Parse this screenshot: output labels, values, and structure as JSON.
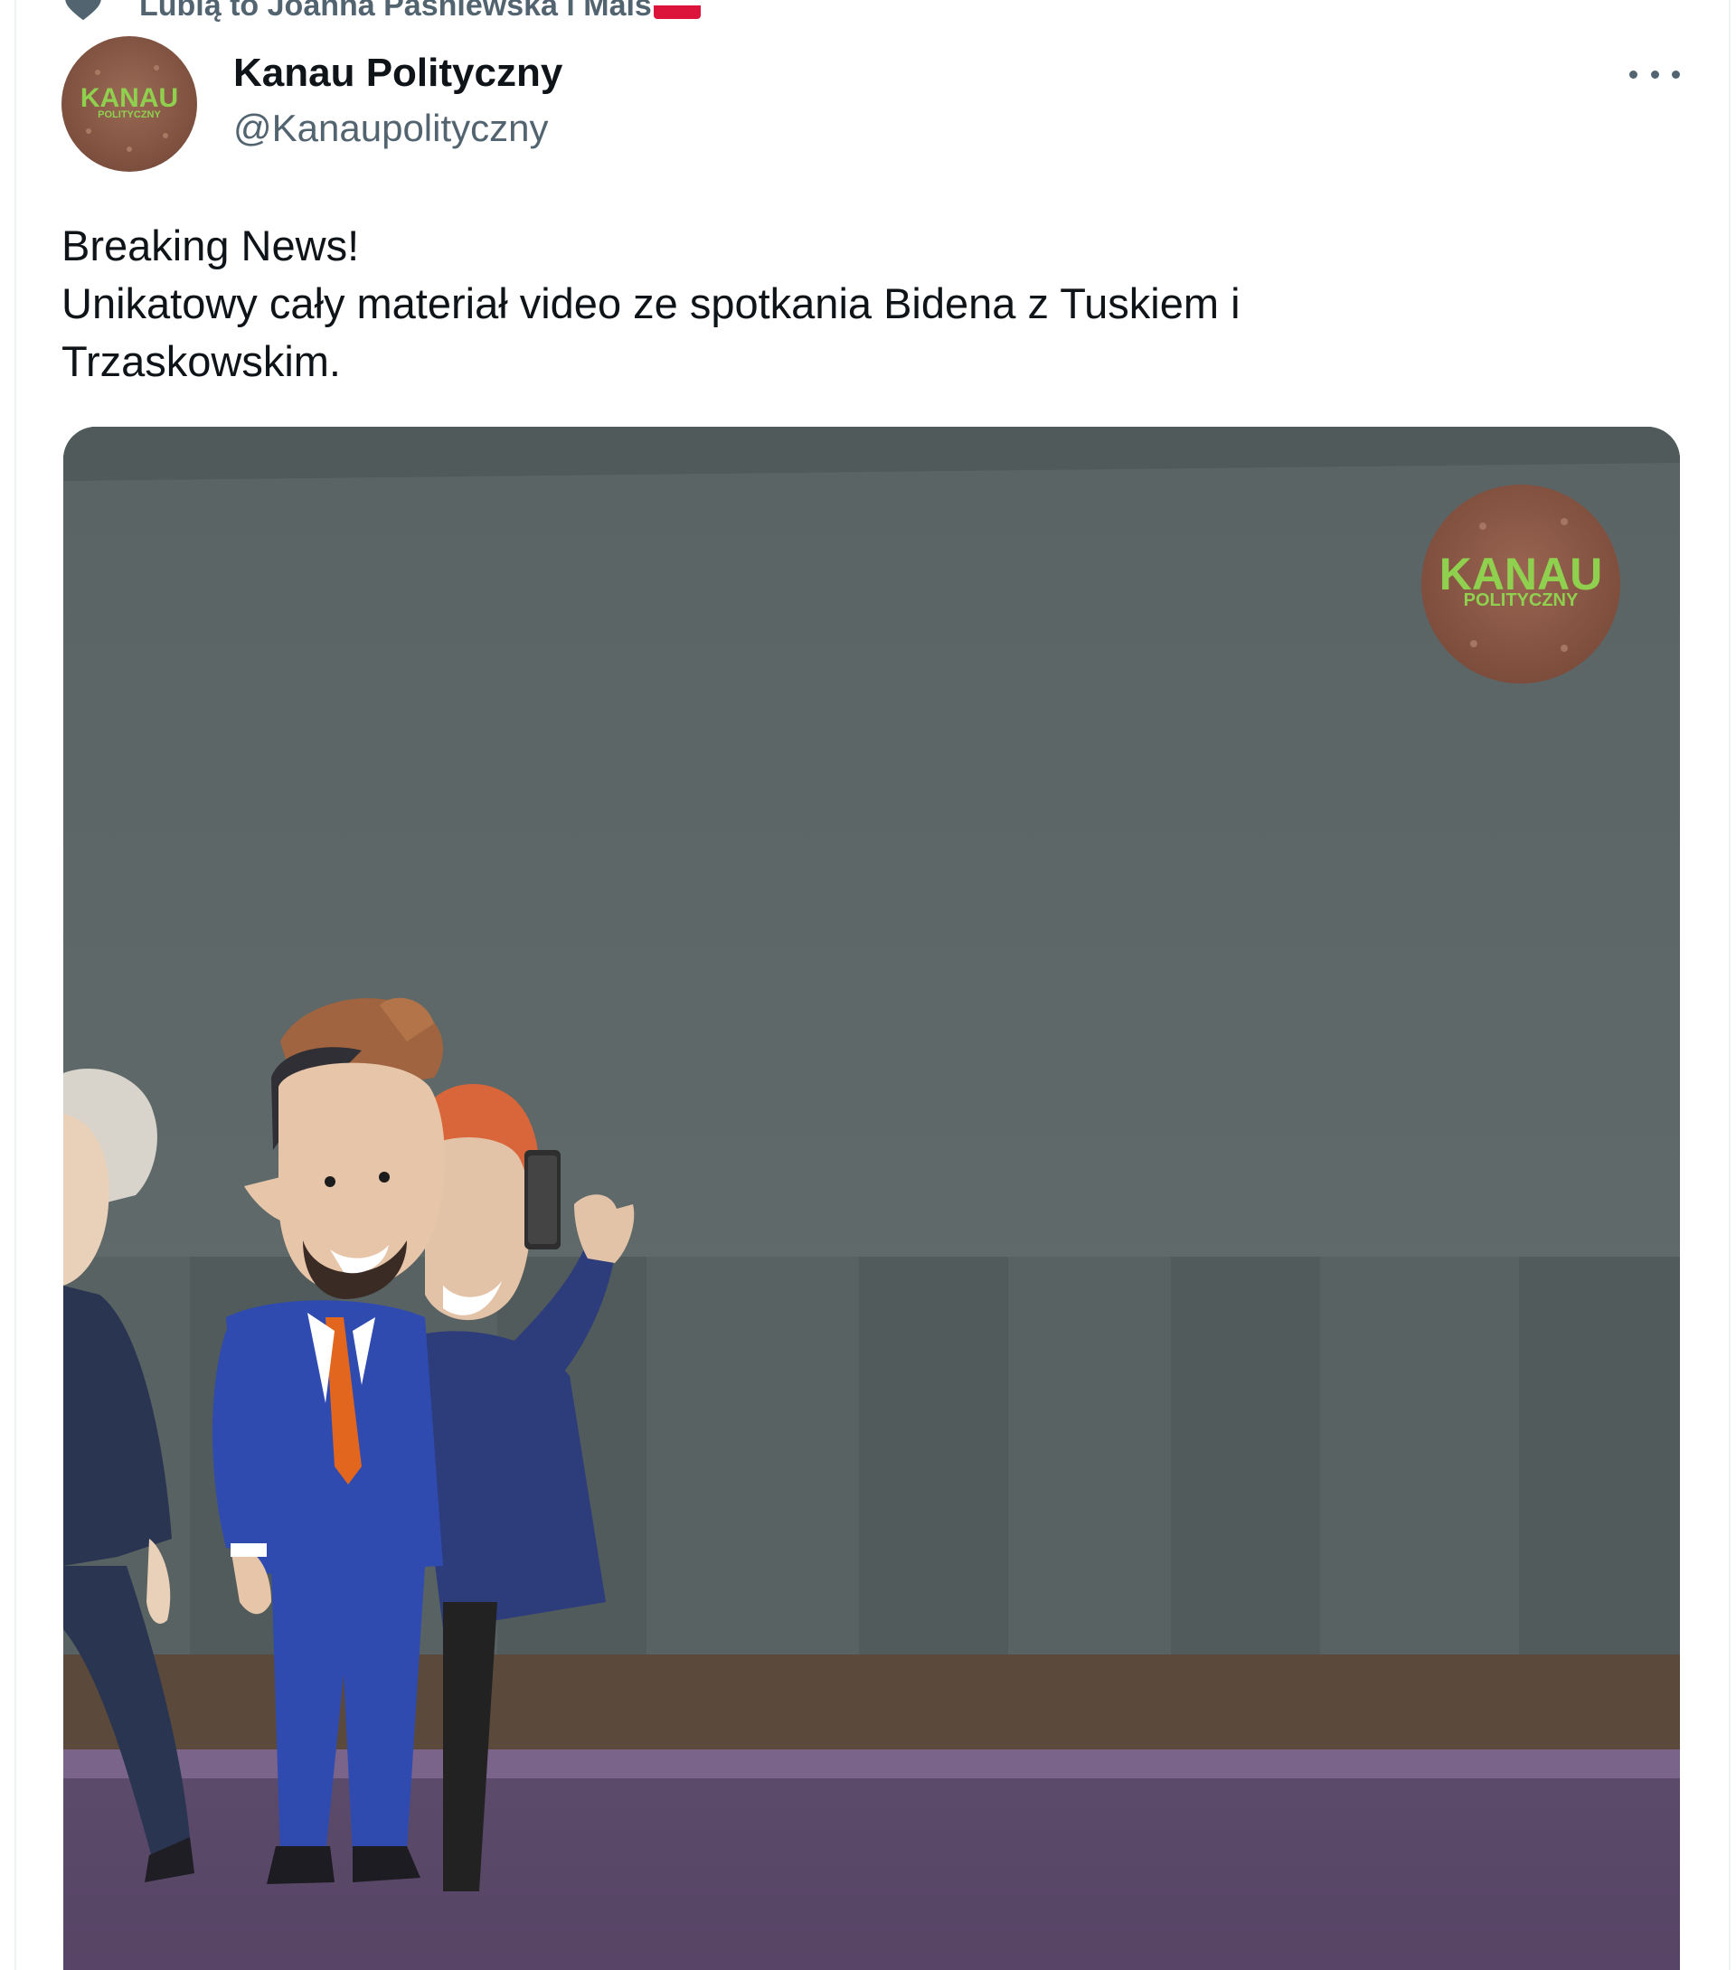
{
  "social_context": {
    "text": "Lubią to Joanna Paśniewska i Mais",
    "icon": "heart-icon",
    "flag": "poland-flag"
  },
  "author": {
    "display_name": "Kanau Polityczny",
    "handle": "@Kanaupolityczny",
    "avatar_logo_text": "KANAU",
    "avatar_logo_subtext": "POLITYCZNY"
  },
  "more_menu": {
    "icon": "more-horizontal-icon"
  },
  "tweet": {
    "lines": [
      "Breaking News!",
      "Unikatowy cały materiał video ze spotkania Bidena z Tuskiem i",
      "Trzaskowskim."
    ]
  },
  "media": {
    "type": "video",
    "watermark_text": "KANAU",
    "watermark_subtext": "POLITYCZNY"
  },
  "colors": {
    "text_primary": "#0f1419",
    "text_secondary": "#536471",
    "logo_green": "#8fd14f",
    "logo_bg": "#8a5a47"
  }
}
